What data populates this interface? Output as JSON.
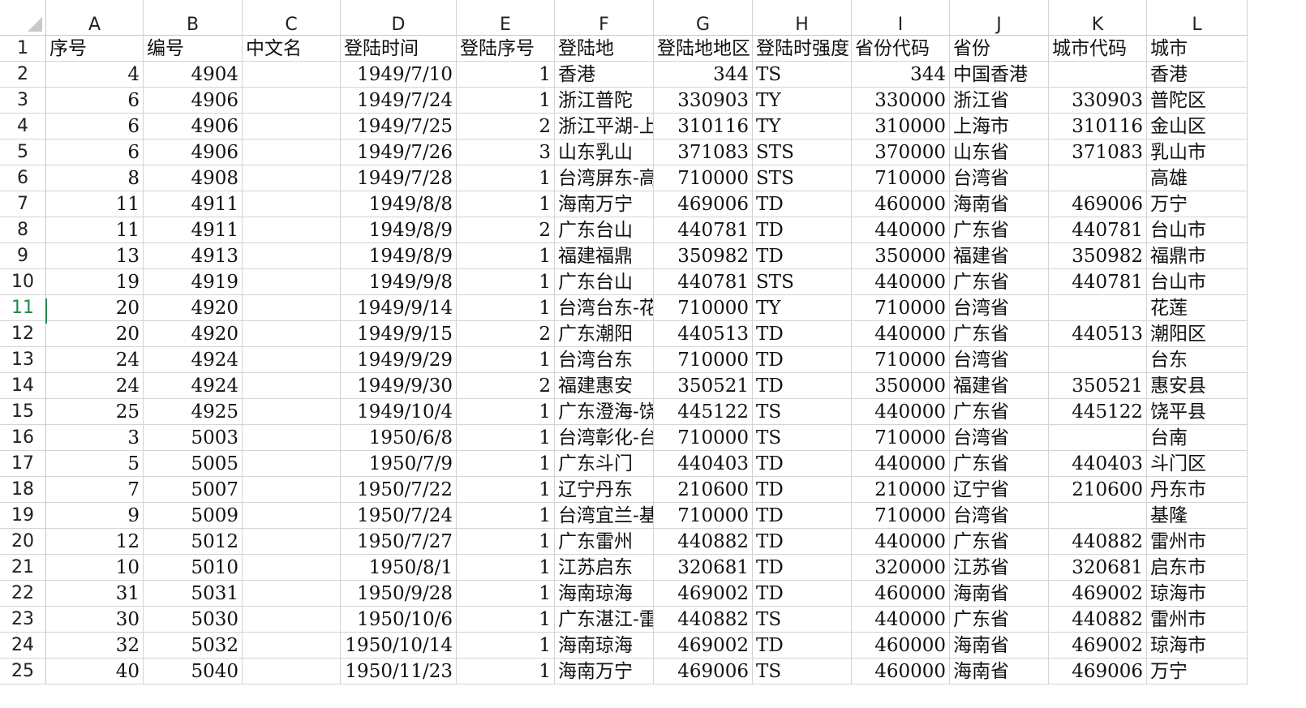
{
  "columns": [
    "A",
    "B",
    "C",
    "D",
    "E",
    "F",
    "G",
    "H",
    "I",
    "J",
    "K",
    "L"
  ],
  "active_row": 11,
  "header_row": [
    "序号",
    "编号",
    "中文名",
    "登陆时间",
    "登陆序号",
    "登陆地",
    "登陆地地区",
    "登陆时强度",
    "省份代码",
    "省份",
    "城市代码",
    "城市"
  ],
  "rows": [
    [
      "4",
      "4904",
      "",
      "1949/7/10",
      "1",
      "香港",
      "344",
      "TS",
      "344",
      "中国香港",
      "",
      "香港"
    ],
    [
      "6",
      "4906",
      "",
      "1949/7/24",
      "1",
      "浙江普陀",
      "330903",
      "TY",
      "330000",
      "浙江省",
      "330903",
      "普陀区"
    ],
    [
      "6",
      "4906",
      "",
      "1949/7/25",
      "2",
      "浙江平湖-上",
      "310116",
      "TY",
      "310000",
      "上海市",
      "310116",
      "金山区"
    ],
    [
      "6",
      "4906",
      "",
      "1949/7/26",
      "3",
      "山东乳山",
      "371083",
      "STS",
      "370000",
      "山东省",
      "371083",
      "乳山市"
    ],
    [
      "8",
      "4908",
      "",
      "1949/7/28",
      "1",
      "台湾屏东-高",
      "710000",
      "STS",
      "710000",
      "台湾省",
      "",
      "高雄"
    ],
    [
      "11",
      "4911",
      "",
      "1949/8/8",
      "1",
      "海南万宁",
      "469006",
      "TD",
      "460000",
      "海南省",
      "469006",
      "万宁"
    ],
    [
      "11",
      "4911",
      "",
      "1949/8/9",
      "2",
      "广东台山",
      "440781",
      "TD",
      "440000",
      "广东省",
      "440781",
      "台山市"
    ],
    [
      "13",
      "4913",
      "",
      "1949/8/9",
      "1",
      "福建福鼎",
      "350982",
      "TD",
      "350000",
      "福建省",
      "350982",
      "福鼎市"
    ],
    [
      "19",
      "4919",
      "",
      "1949/9/8",
      "1",
      "广东台山",
      "440781",
      "STS",
      "440000",
      "广东省",
      "440781",
      "台山市"
    ],
    [
      "20",
      "4920",
      "",
      "1949/9/14",
      "1",
      "台湾台东-花",
      "710000",
      "TY",
      "710000",
      "台湾省",
      "",
      "花莲"
    ],
    [
      "20",
      "4920",
      "",
      "1949/9/15",
      "2",
      "广东潮阳",
      "440513",
      "TD",
      "440000",
      "广东省",
      "440513",
      "潮阳区"
    ],
    [
      "24",
      "4924",
      "",
      "1949/9/29",
      "1",
      "台湾台东",
      "710000",
      "TD",
      "710000",
      "台湾省",
      "",
      "台东"
    ],
    [
      "24",
      "4924",
      "",
      "1949/9/30",
      "2",
      "福建惠安",
      "350521",
      "TD",
      "350000",
      "福建省",
      "350521",
      "惠安县"
    ],
    [
      "25",
      "4925",
      "",
      "1949/10/4",
      "1",
      "广东澄海-饶",
      "445122",
      "TS",
      "440000",
      "广东省",
      "445122",
      "饶平县"
    ],
    [
      "3",
      "5003",
      "",
      "1950/6/8",
      "1",
      "台湾彰化-台",
      "710000",
      "TS",
      "710000",
      "台湾省",
      "",
      "台南"
    ],
    [
      "5",
      "5005",
      "",
      "1950/7/9",
      "1",
      "广东斗门",
      "440403",
      "TD",
      "440000",
      "广东省",
      "440403",
      "斗门区"
    ],
    [
      "7",
      "5007",
      "",
      "1950/7/22",
      "1",
      "辽宁丹东",
      "210600",
      "TD",
      "210000",
      "辽宁省",
      "210600",
      "丹东市"
    ],
    [
      "9",
      "5009",
      "",
      "1950/7/24",
      "1",
      "台湾宜兰-基",
      "710000",
      "TD",
      "710000",
      "台湾省",
      "",
      "基隆"
    ],
    [
      "12",
      "5012",
      "",
      "1950/7/27",
      "1",
      "广东雷州",
      "440882",
      "TD",
      "440000",
      "广东省",
      "440882",
      "雷州市"
    ],
    [
      "10",
      "5010",
      "",
      "1950/8/1",
      "1",
      "江苏启东",
      "320681",
      "TD",
      "320000",
      "江苏省",
      "320681",
      "启东市"
    ],
    [
      "31",
      "5031",
      "",
      "1950/9/28",
      "1",
      "海南琼海",
      "469002",
      "TD",
      "460000",
      "海南省",
      "469002",
      "琼海市"
    ],
    [
      "30",
      "5030",
      "",
      "1950/10/6",
      "1",
      "广东湛江-雷",
      "440882",
      "TS",
      "440000",
      "广东省",
      "440882",
      "雷州市"
    ],
    [
      "32",
      "5032",
      "",
      "1950/10/14",
      "1",
      "海南琼海",
      "469002",
      "TD",
      "460000",
      "海南省",
      "469002",
      "琼海市"
    ],
    [
      "40",
      "5040",
      "",
      "1950/11/23",
      "1",
      "海南万宁",
      "469006",
      "TS",
      "460000",
      "海南省",
      "469006",
      "万宁"
    ]
  ]
}
